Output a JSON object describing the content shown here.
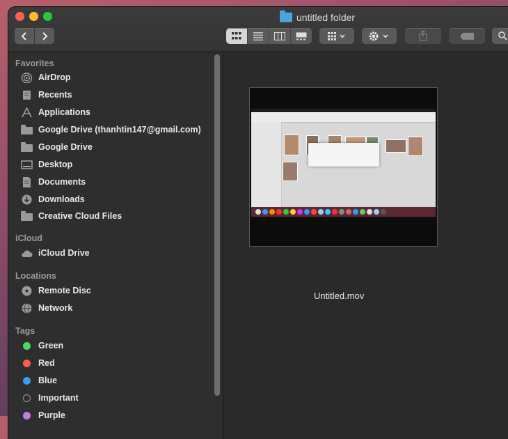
{
  "window": {
    "title": "untitled folder"
  },
  "toolbar": {
    "back_icon": "chevron-left-icon",
    "forward_icon": "chevron-right-icon",
    "view_modes": [
      "icon-view",
      "list-view",
      "column-view",
      "gallery-view"
    ],
    "group_icon": "group-by-icon",
    "action_icon": "gear-icon",
    "share_icon": "share-icon",
    "tag_icon": "tag-icon",
    "search_icon": "search-icon"
  },
  "sidebar": {
    "favorites_header": "Favorites",
    "favorites": [
      {
        "label": "AirDrop",
        "icon": "airdrop-icon"
      },
      {
        "label": "Recents",
        "icon": "recents-icon"
      },
      {
        "label": "Applications",
        "icon": "applications-icon"
      },
      {
        "label": "Google Drive (thanhtin147@gmail.com)",
        "icon": "folder-icon"
      },
      {
        "label": "Google Drive",
        "icon": "folder-icon"
      },
      {
        "label": "Desktop",
        "icon": "desktop-icon"
      },
      {
        "label": "Documents",
        "icon": "documents-icon"
      },
      {
        "label": "Downloads",
        "icon": "downloads-icon"
      },
      {
        "label": "Creative Cloud Files",
        "icon": "folder-icon"
      }
    ],
    "icloud_header": "iCloud",
    "icloud": [
      {
        "label": "iCloud Drive",
        "icon": "cloud-icon"
      }
    ],
    "locations_header": "Locations",
    "locations": [
      {
        "label": "Remote Disc",
        "icon": "disc-icon"
      },
      {
        "label": "Network",
        "icon": "network-icon"
      }
    ],
    "tags_header": "Tags",
    "tags": [
      {
        "label": "Green",
        "color": "#4cd964"
      },
      {
        "label": "Red",
        "color": "#ff5b52"
      },
      {
        "label": "Blue",
        "color": "#3a9cf5"
      },
      {
        "label": "Important",
        "color": ""
      },
      {
        "label": "Purple",
        "color": "#c27ce8"
      }
    ]
  },
  "content": {
    "files": [
      {
        "name": "Untitled.mov"
      }
    ]
  }
}
